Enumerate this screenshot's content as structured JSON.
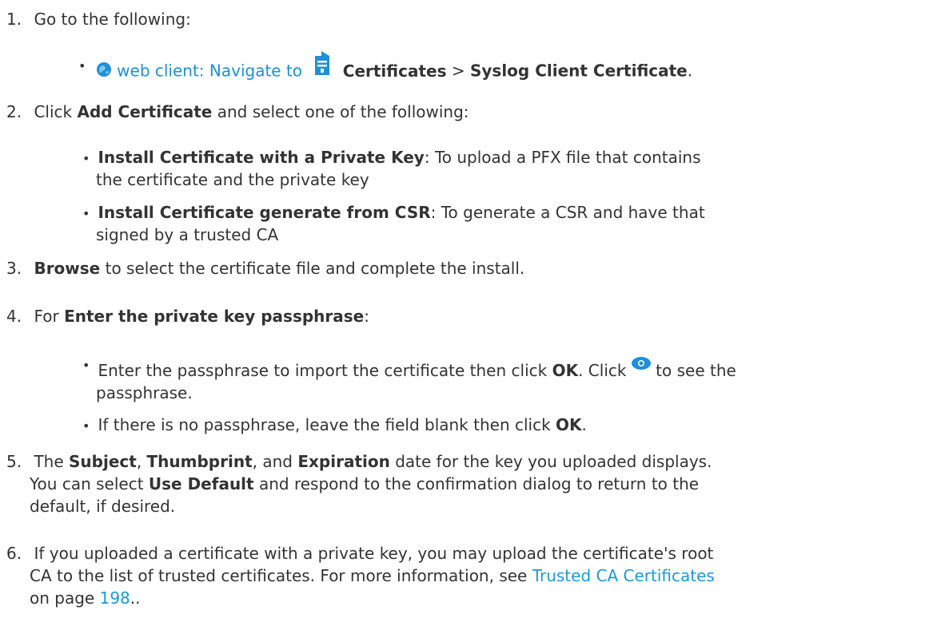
{
  "steps": {
    "s1": {
      "num": "1.",
      "text": "Go to the following:",
      "bullet": {
        "pre": "web client: Navigate to",
        "b1": "Certificates",
        "sep": ">",
        "b2": "Syslog Client Certificate",
        "end": "."
      }
    },
    "s2": {
      "num": "2.",
      "pre": "Click",
      "b": "Add Certificate",
      "post": "and select one of the following:",
      "opt1": {
        "b": "Install Certificate with a Private Key",
        "l1": ": To upload a PFX file that contains",
        "l2": "the certificate and the private key"
      },
      "opt2": {
        "b": "Install Certificate generate from CSR",
        "l1": ": To generate a CSR and have that",
        "l2": "signed by a trusted CA"
      }
    },
    "s3": {
      "num": "3.",
      "b": "Browse",
      "post": "to select the certificate file and complete the install."
    },
    "s4": {
      "num": "4.",
      "pre": "For",
      "b": "Enter the private key passphrase",
      "post": ":",
      "bul1": {
        "pre": "Enter the passphrase to import the certificate then click",
        "b": "OK",
        "mid": ". Click",
        "post": "to see the",
        "l2": "passphrase."
      },
      "bul2": {
        "pre": "If there is no passphrase, leave the field blank then click",
        "b": "OK",
        "post": "."
      }
    },
    "s5": {
      "num": "5.",
      "pre": "The",
      "b1": "Subject",
      "c1": ",",
      "b2": "Thumbprint",
      "c2": ", and",
      "b3": "Expiration",
      "post": "date for the key you uploaded displays.",
      "l2pre": "You can select",
      "l2b": "Use Default",
      "l2post": "and respond to the confirmation dialog to return to the",
      "l3": "default, if desired."
    },
    "s6": {
      "num": "6.",
      "l1": "If you uploaded a certificate with a private key, you may upload the certificate's root",
      "l2": "CA to the list of trusted certificates. For more information, see",
      "link": "Trusted CA Certificates",
      "l3pre": "on page",
      "page": "198",
      "l3post": ".."
    }
  },
  "colors": {
    "text": "#333333",
    "link": "#1a9bd7",
    "icon": "#1e90d6"
  },
  "icons": [
    "globe-icon",
    "certificate-doc-icon",
    "eye-icon"
  ]
}
